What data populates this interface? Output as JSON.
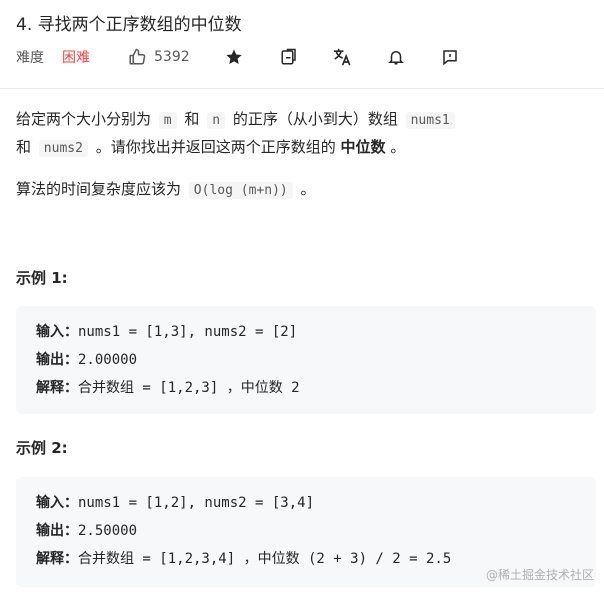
{
  "problem": {
    "title": "4. 寻找两个正序数组的中位数",
    "difficulty_label": "难度",
    "difficulty_value": "困难",
    "likes": "5392"
  },
  "description": {
    "p1_a": "给定两个大小分别为",
    "m": "m",
    "p1_and": "和",
    "n": "n",
    "p1_b": "的正序（从小到大）数组",
    "nums1": "nums1",
    "p2_a": "和",
    "nums2": "nums2",
    "p2_b": "。请你找出并返回这两个正序数组的",
    "median": "中位数",
    "p2_c": "。",
    "p3_a": "算法的时间复杂度应该为",
    "complexity": "O(log (m+n))",
    "p3_b": "。"
  },
  "examples": [
    {
      "title": "示例 1:",
      "input_label": "输入：",
      "input": "nums1 = [1,3], nums2 = [2]",
      "output_label": "输出：",
      "output": "2.00000",
      "explain_label": "解释：",
      "explain": "合并数组 = [1,2,3] ，中位数 2"
    },
    {
      "title": "示例 2:",
      "input_label": "输入：",
      "input": "nums1 = [1,2], nums2 = [3,4]",
      "output_label": "输出：",
      "output": "2.50000",
      "explain_label": "解释：",
      "explain": "合并数组 = [1,2,3,4] ，中位数 (2 + 3) / 2 = 2.5"
    }
  ],
  "icons": {
    "like": "thumbs-up-icon",
    "star": "star-icon",
    "share": "share-icon",
    "translate": "translate-icon",
    "bell": "bell-icon",
    "feedback": "feedback-icon"
  },
  "colors": {
    "difficulty_hard": "#ef4743",
    "text": "#262626",
    "code_bg": "#f7f8fa"
  },
  "watermark": "@稀土掘金技术社区"
}
